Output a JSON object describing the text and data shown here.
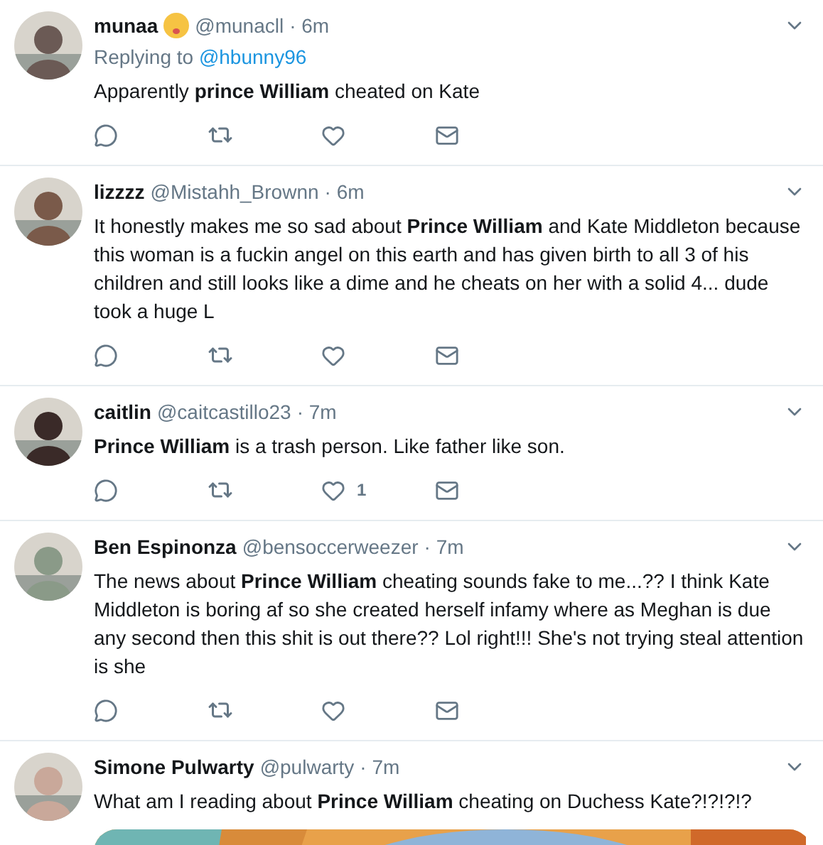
{
  "tweets": [
    {
      "kind": "text",
      "name": "munaa",
      "emoji": true,
      "handle": "@munacll",
      "time": "· 6m",
      "replying_prefix": "Replying to",
      "replying_to": "@hbunny96",
      "text": "Apparently **prince William** cheated on Kate"
    },
    {
      "kind": "text",
      "name": "lizzzz",
      "handle": "@Mistahh_Brownn",
      "time": "· 6m",
      "text": "It honestly makes me so sad about **Prince William** and Kate Middleton because this woman is a fuckin angel on this earth and has given birth to all 3 of his children and still looks like a dime and he cheats on her with a solid 4... dude took a huge L"
    },
    {
      "kind": "text",
      "name": "caitlin",
      "handle": "@caitcastillo23",
      "time": "· 7m",
      "text": "**Prince William** is a trash person. Like father like son.",
      "like_count": "1"
    },
    {
      "kind": "text",
      "name": "Ben Espinonza",
      "handle": "@bensoccerweezer",
      "time": "· 7m",
      "text": "The news about **Prince William** cheating sounds fake to me...?? I think Kate Middleton is boring af so she created herself infamy where as Meghan is due any second then this shit is out there?? Lol right!!!  She's not trying steal attention is she"
    },
    {
      "kind": "media",
      "name": "Simone Pulwarty",
      "handle": "@pulwarty",
      "time": "· 7m",
      "text": "What am I reading about **Prince William** cheating on Duchess Kate?!?!?!?"
    }
  ]
}
